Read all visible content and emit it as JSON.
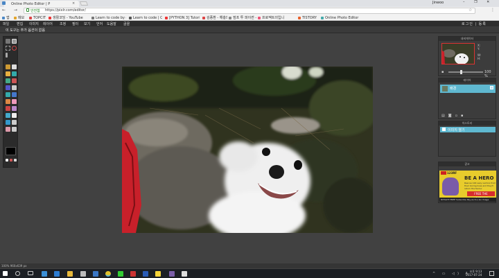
{
  "browser": {
    "tab_title": "Online Photo Editor | P",
    "profile": "Jinwoo",
    "window_controls": "– ❐ ✕",
    "nav_glyphs": "← → C",
    "security_label": "안전함",
    "url": "https://pixlr.com/editor/",
    "bookmarks": [
      {
        "label": "앱",
        "color": "#4a86c5"
      },
      {
        "label": "메모",
        "color": "#e3a52b"
      },
      {
        "label": "TOPCIT",
        "color": "#d44"
      },
      {
        "label": "생활코딩 - YouTube",
        "color": "#e33"
      },
      {
        "label": "Learn to code by d",
        "color": "#777"
      },
      {
        "label": "Learn to code | Cod",
        "color": "#555"
      },
      {
        "label": "[PYTHON 3] Tutori",
        "color": "#e33"
      },
      {
        "label": "김종환 - 해충파트 ㅎ",
        "color": "#d44"
      },
      {
        "label": "점프 투 파이썬 - Wi",
        "color": "#888"
      },
      {
        "label": "프로젝트의입니",
        "color": "#e57"
      },
      {
        "label": "TISTORY",
        "color": "#e8612c"
      },
      {
        "label": "Online Photo Editor",
        "color": "#4aa"
      }
    ]
  },
  "app": {
    "menu": [
      "파일",
      "편집",
      "이미지",
      "레이어",
      "조정",
      "필터",
      "보기",
      "언어",
      "도움말",
      "글꼴"
    ],
    "user": "로그인 | 등록",
    "option_text": "이 도구는 추가 옵션이 없음",
    "status_text": "100%  960x639 px"
  },
  "navigator": {
    "title": "내비게이터",
    "x_label": "X:",
    "y_label": "Y:",
    "w_label": "W:",
    "h_label": "H:",
    "zoom": "100",
    "zoom_unit": "%"
  },
  "layers": {
    "title": "레이어",
    "items": [
      {
        "name": "배경"
      }
    ]
  },
  "history": {
    "title": "히스토리",
    "items": [
      {
        "name": "이미지 열기"
      }
    ]
  },
  "ad": {
    "title": "광고",
    "brand": "123RF",
    "headline": "BE A HERO",
    "sub": "Rescue 100 sexy vectors from their boring lives and they'll return the favour",
    "button": "FREE THE VECTORS!",
    "footer": "ROYALTY-FREE  Subscribe   Pay-As-You-Go   Image Credits"
  },
  "taskbar": {
    "time": "오후 9:13",
    "date": "2017-07-24"
  }
}
